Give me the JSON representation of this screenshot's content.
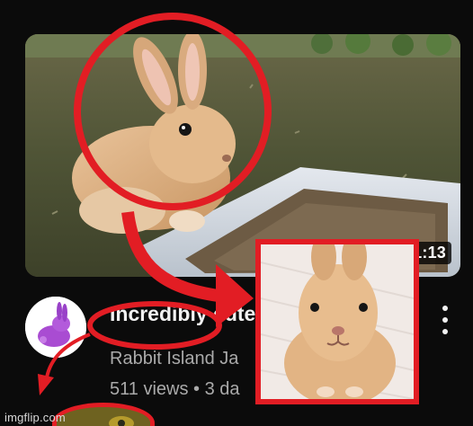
{
  "video": {
    "duration": "1:13",
    "title": "Incredibly cute",
    "channel": "Rabbit Island Ja",
    "meta": "511 views • 3 da"
  },
  "icons": {
    "more": "more-vert-icon",
    "avatar": "rabbit-icon"
  },
  "colors": {
    "background": "#0b0b0b",
    "annotation_red": "#e21d24",
    "secondary_text": "#aaaaaa"
  },
  "watermark": "imgflip.com"
}
